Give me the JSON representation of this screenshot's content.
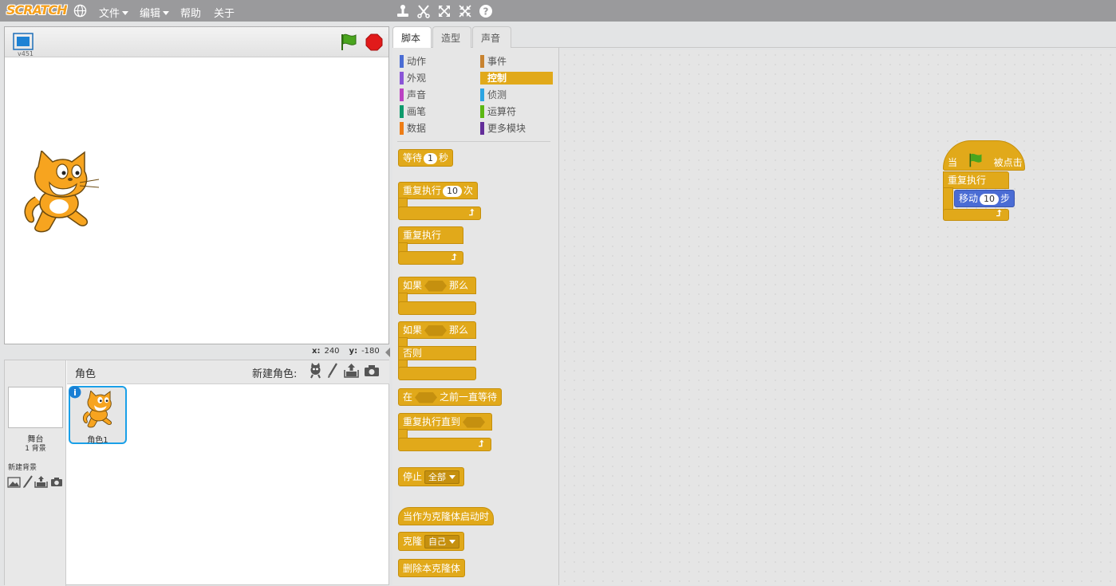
{
  "menubar": {
    "logo_text": "SCRATCH",
    "items": [
      {
        "label": "文件",
        "caret": true
      },
      {
        "label": "编辑",
        "caret": true
      },
      {
        "label": "帮助",
        "caret": false
      },
      {
        "label": "关于",
        "caret": false
      }
    ],
    "tool_icons": [
      "duplicate-icon",
      "delete-icon",
      "grow-icon",
      "shrink-icon",
      "help-icon"
    ]
  },
  "stage": {
    "version": "v451",
    "coords": {
      "x_label": "x:",
      "x_value": "240",
      "y_label": "y:",
      "y_value": "-180"
    }
  },
  "sprites": {
    "header_label": "角色",
    "new_sprite_label": "新建角色:",
    "stage_label": "舞台",
    "stage_backdrop_count": "1 背景",
    "new_backdrop_label": "新建背景",
    "sprite_items": [
      {
        "name": "角色1",
        "selected": true
      }
    ]
  },
  "tabs": [
    {
      "label": "脚本",
      "active": true
    },
    {
      "label": "造型",
      "active": false
    },
    {
      "label": "声音",
      "active": false
    }
  ],
  "palette": {
    "categories_left": [
      {
        "label": "动作",
        "color": "#4a6cd4"
      },
      {
        "label": "外观",
        "color": "#8a55d7"
      },
      {
        "label": "声音",
        "color": "#bb42c3"
      },
      {
        "label": "画笔",
        "color": "#0e9a6c"
      },
      {
        "label": "数据",
        "color": "#ee7d16"
      }
    ],
    "categories_right": [
      {
        "label": "事件",
        "color": "#c88330"
      },
      {
        "label": "控制",
        "color": "#e1a91a",
        "selected": true
      },
      {
        "label": "侦测",
        "color": "#2ca5e2"
      },
      {
        "label": "运算符",
        "color": "#5cb712"
      },
      {
        "label": "更多模块",
        "color": "#632d99"
      }
    ],
    "blocks": {
      "wait": {
        "pre": "等待",
        "num": "1",
        "post": "秒"
      },
      "repeat": {
        "pre": "重复执行",
        "num": "10",
        "post": "次"
      },
      "forever": {
        "label": "重复执行"
      },
      "if_then": {
        "pre": "如果",
        "post": "那么"
      },
      "if_else": {
        "pre": "如果",
        "post": "那么",
        "else": "否则"
      },
      "wait_until": {
        "pre": "在",
        "post": "之前一直等待"
      },
      "repeat_until": {
        "label": "重复执行直到"
      },
      "stop": {
        "label": "停止",
        "option": "全部"
      },
      "when_clone": {
        "label": "当作为克隆体启动时"
      },
      "clone": {
        "label": "克隆",
        "option": "自己"
      },
      "delete_clone": {
        "label": "删除本克隆体"
      }
    }
  },
  "script": {
    "hat": {
      "pre": "当",
      "post": "被点击"
    },
    "forever": {
      "label": "重复执行"
    },
    "move": {
      "pre": "移动",
      "num": "10",
      "post": "步"
    }
  }
}
